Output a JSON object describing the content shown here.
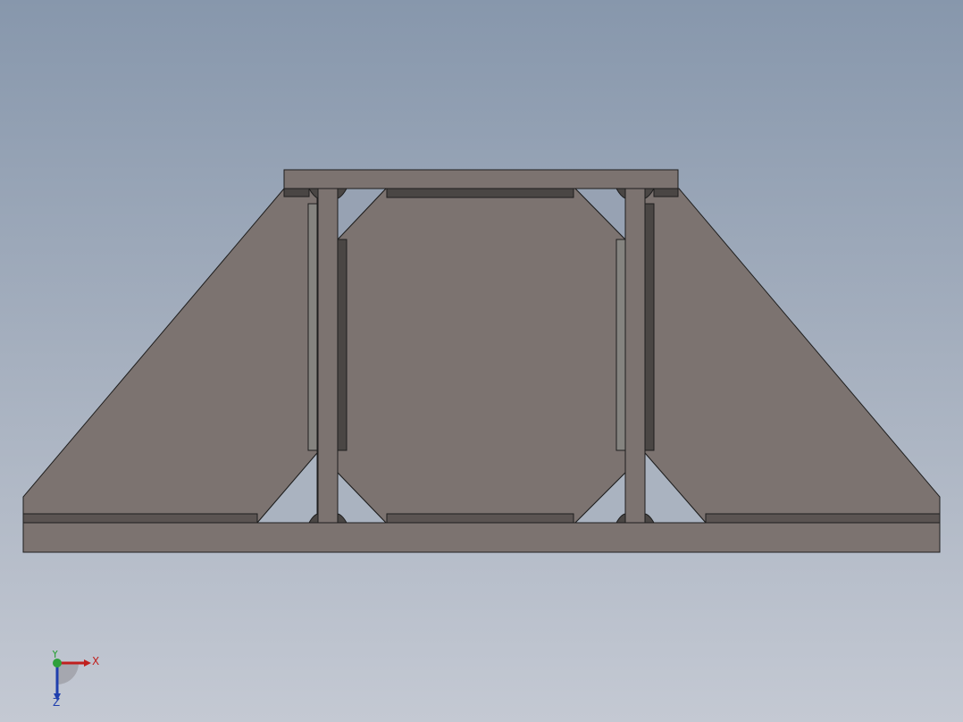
{
  "viewport": {
    "background_top": "#8797ac",
    "background_bottom": "#c4c9d3"
  },
  "model": {
    "part_color": "#7c7370",
    "dark_color": "#4a4644",
    "edge_color": "#1e1e1e",
    "light_plate_color": "#858480"
  },
  "triad": {
    "x_label": "X",
    "y_label": "Y",
    "z_label": "Z",
    "x_color": "#c0201e",
    "y_color": "#2ea03a",
    "z_color": "#1f3fae"
  }
}
